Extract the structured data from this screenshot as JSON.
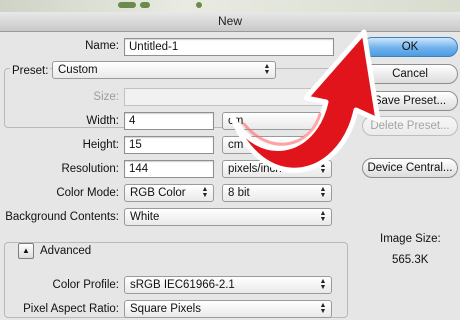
{
  "window": {
    "title": "New"
  },
  "name": {
    "label": "Name:",
    "value": "Untitled-1"
  },
  "preset": {
    "label": "Preset:",
    "value": "Custom"
  },
  "size": {
    "label": "Size:",
    "value": ""
  },
  "width": {
    "label": "Width:",
    "value": "4",
    "unit": "cm"
  },
  "height": {
    "label": "Height:",
    "value": "15",
    "unit": "cm"
  },
  "resolution": {
    "label": "Resolution:",
    "value": "144",
    "unit": "pixels/inch"
  },
  "color_mode": {
    "label": "Color Mode:",
    "value": "RGB Color",
    "depth": "8 bit"
  },
  "background": {
    "label": "Background Contents:",
    "value": "White"
  },
  "advanced": {
    "label": "Advanced",
    "color_profile_label": "Color Profile:",
    "color_profile_value": "sRGB IEC61966-2.1",
    "pixel_ratio_label": "Pixel Aspect Ratio:",
    "pixel_ratio_value": "Square Pixels"
  },
  "buttons": {
    "ok": "OK",
    "cancel": "Cancel",
    "save_preset": "Save Preset...",
    "delete_preset": "Delete Preset...",
    "device_central": "Device Central..."
  },
  "image_size": {
    "label": "Image Size:",
    "value": "565.3K"
  },
  "icons": {
    "select_arrows": "updown-arrows-icon",
    "disclosure": "triangle-up-icon",
    "overlay_pointer": "curved-arrow-icon"
  },
  "colors": {
    "ok_button": "#5aa4e8",
    "overlay_arrow": "#e1141c"
  }
}
